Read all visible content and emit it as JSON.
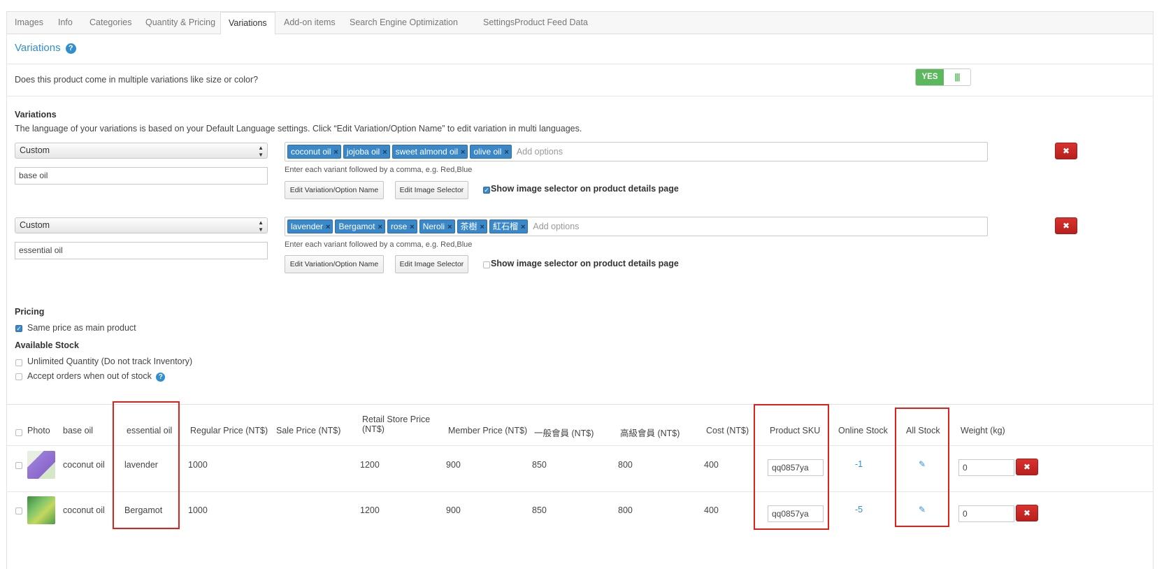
{
  "tabs": [
    "Images",
    "Info",
    "Categories",
    "Quantity & Pricing",
    "Variations",
    "Add-on items",
    "Search Engine Optimization",
    "Settings",
    "Product Feed Data"
  ],
  "active_tab": "Variations",
  "section_title": "Variations",
  "question": "Does this product come in multiple variations like size or color?",
  "toggle": {
    "yes_label": "YES",
    "bars": "|||"
  },
  "variations_heading": "Variations",
  "variations_desc": "The language of your variations is based on your Default Language settings. Click “Edit Variation/Option Name” to edit variation in multi languages.",
  "variation_groups": [
    {
      "type": "Custom",
      "name": "base oil",
      "tags": [
        "coconut oil",
        "jojoba oil",
        "sweet almond oil",
        "olive oil"
      ],
      "placeholder": "Add options",
      "hint": "Enter each variant followed by a comma, e.g. Red,Blue",
      "edit_name_btn": "Edit Variation/Option Name",
      "edit_image_btn": "Edit Image Selector",
      "show_image_label": "Show image selector on product details page",
      "show_image_checked": true
    },
    {
      "type": "Custom",
      "name": "essential oil",
      "tags": [
        "lavender",
        "Bergamot",
        "rose",
        "Neroli",
        "茶樹",
        "紅石榴"
      ],
      "placeholder": "Add options",
      "hint": "Enter each variant followed by a comma, e.g. Red,Blue",
      "edit_name_btn": "Edit Variation/Option Name",
      "edit_image_btn": "Edit Image Selector",
      "show_image_label": "Show image selector on product details page",
      "show_image_checked": false
    }
  ],
  "tag_remove_glyph": "×",
  "delete_glyph": "✖",
  "pricing_heading": "Pricing",
  "same_price_label": "Same price as main product",
  "same_price_checked": true,
  "stock_heading": "Available Stock",
  "unlimited_label": "Unlimited Quantity (Do not track Inventory)",
  "accept_orders_label": "Accept orders when out of stock",
  "help_glyph": "?",
  "table": {
    "headers": {
      "photo": "Photo",
      "base_oil": "base oil",
      "essential_oil": "essential oil",
      "regular_price": "Regular Price (NT$)",
      "sale_price": "Sale Price (NT$)",
      "retail_price_1": "Retail Store Price",
      "retail_price_2": "(NT$)",
      "member_price": "Member Price (NT$)",
      "general_member": "一般會員 (NT$)",
      "senior_member": "高級會員 (NT$)",
      "cost": "Cost (NT$)",
      "sku": "Product SKU",
      "online_stock": "Online Stock",
      "all_stock": "All Stock",
      "weight": "Weight (kg)"
    },
    "rows": [
      {
        "base_oil": "coconut oil",
        "essential_oil": "lavender",
        "regular_price": "1000",
        "retail_price": "1200",
        "member_price": "900",
        "general_member": "850",
        "senior_member": "800",
        "cost": "400",
        "sku": "qq0857ya",
        "online_stock": "-1",
        "weight": "0"
      },
      {
        "base_oil": "coconut oil",
        "essential_oil": "Bergamot",
        "regular_price": "1000",
        "retail_price": "1200",
        "member_price": "900",
        "general_member": "850",
        "senior_member": "800",
        "cost": "400",
        "sku": "qq0857ya",
        "online_stock": "-5",
        "weight": "0"
      }
    ]
  },
  "colors": {
    "accent": "#2f8fcf",
    "tag": "#3b88c9",
    "toggle_on": "#5cb85c",
    "danger": "#c9302c",
    "highlight": "#e0201a"
  }
}
